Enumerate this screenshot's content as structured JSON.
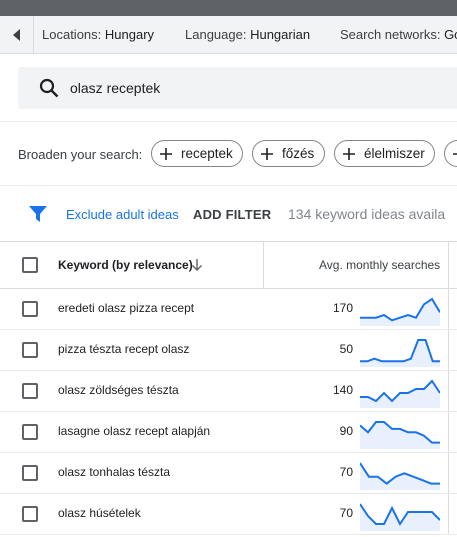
{
  "filters": {
    "locations_label": "Locations:",
    "locations_value": "Hungary",
    "language_label": "Language:",
    "language_value": "Hungarian",
    "networks_label": "Search networks:",
    "networks_value": "Go"
  },
  "search": {
    "query": "olasz receptek"
  },
  "broaden": {
    "label": "Broaden your search:",
    "chips": [
      "receptek",
      "főzés",
      "élelmiszer"
    ]
  },
  "actions": {
    "exclude_label": "Exclude adult ideas",
    "add_filter_label": "ADD FILTER",
    "idea_count_text": "134 keyword ideas availa"
  },
  "table": {
    "keyword_header": "Keyword (by relevance)",
    "searches_header": "Avg. monthly searches",
    "rows": [
      {
        "keyword": "eredeti olasz pizza recept",
        "searches": "170",
        "trend": [
          2,
          2,
          2,
          3,
          1,
          2,
          3,
          2,
          7,
          9,
          4
        ]
      },
      {
        "keyword": "pizza tészta recept olasz",
        "searches": "50",
        "trend": [
          1,
          1,
          2,
          1,
          1,
          1,
          1,
          2,
          9,
          9,
          1,
          1
        ]
      },
      {
        "keyword": "olasz zöldséges tészta",
        "searches": "140",
        "trend": [
          2,
          2,
          1,
          3,
          1,
          3,
          3,
          4,
          4,
          6,
          3
        ]
      },
      {
        "keyword": "lasagne olasz recept alapján",
        "searches": "90",
        "trend": [
          6,
          4,
          7,
          7,
          5,
          5,
          4,
          4,
          3,
          1,
          1
        ]
      },
      {
        "keyword": "olasz tonhalas tészta",
        "searches": "70",
        "trend": [
          7,
          3,
          3,
          1,
          3,
          4,
          3,
          2,
          1,
          1
        ]
      },
      {
        "keyword": "olasz húsételek",
        "searches": "70",
        "trend": [
          6,
          3,
          1,
          1,
          5,
          1,
          4,
          4,
          4,
          4,
          2
        ]
      }
    ]
  },
  "colors": {
    "accent": "#1a73e8",
    "sparkline": "#1a73e8",
    "sparkline_fill": "#e8f0fe"
  }
}
